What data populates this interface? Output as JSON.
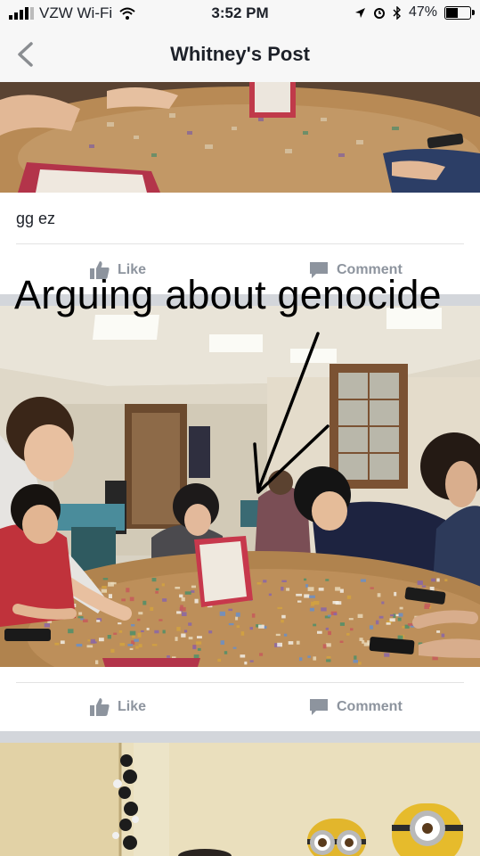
{
  "status_bar": {
    "carrier": "VZW Wi-Fi",
    "time": "3:52 PM",
    "battery_percent": "47%",
    "battery_level": 0.47,
    "icons": [
      "signal-icon",
      "wifi-icon",
      "location-icon",
      "alarm-icon",
      "bluetooth-icon",
      "battery-icon"
    ]
  },
  "nav": {
    "title": "Whitney's Post",
    "back_icon": "chevron-left-icon"
  },
  "posts": [
    {
      "caption": "gg ez",
      "like_label": "Like",
      "comment_label": "Comment"
    },
    {
      "overlay_text": "Arguing about genocide",
      "like_label": "Like",
      "comment_label": "Comment"
    }
  ],
  "colors": {
    "bar_bg": "#f7f7f7",
    "action_gray": "#8d949e",
    "separator": "#d3d6db"
  }
}
